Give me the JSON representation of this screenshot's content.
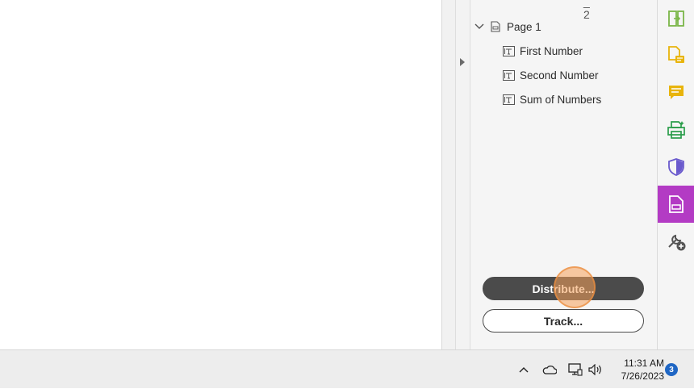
{
  "panel": {
    "top_glyphs": "_ 2",
    "tree": {
      "page_label": "Page 1",
      "fields": [
        "First Number",
        "Second Number",
        "Sum of Numbers"
      ]
    },
    "distribute_label": "Distribute...",
    "track_label": "Track..."
  },
  "toolbar": {
    "tools": [
      {
        "name": "organize-pages-icon",
        "color": "#7ab648"
      },
      {
        "name": "comment-file-icon",
        "color": "#e8b40c"
      },
      {
        "name": "comment-icon",
        "color": "#e8b40c"
      },
      {
        "name": "print-production-icon",
        "color": "#2a9d4a"
      },
      {
        "name": "protect-shield-icon",
        "color": "#6a5acd"
      },
      {
        "name": "prepare-form-icon",
        "color": "#b33bc4",
        "active": true
      },
      {
        "name": "more-tools-icon",
        "color": "#555555"
      }
    ]
  },
  "taskbar": {
    "time": "11:31 AM",
    "date": "7/26/2023",
    "notification_count": "3"
  }
}
